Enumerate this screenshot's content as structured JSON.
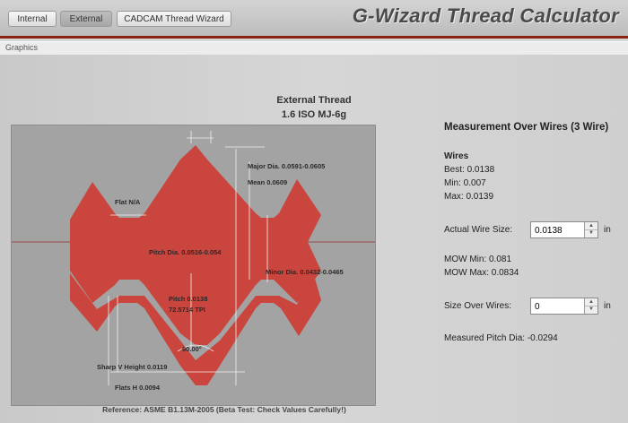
{
  "tabs": [
    {
      "label": "Internal",
      "active": false
    },
    {
      "label": "External",
      "active": true
    },
    {
      "label": "CADCAM Thread Wizard",
      "active": false
    }
  ],
  "app_title": "G-Wizard Thread Calculator",
  "section": {
    "label": "Graphics"
  },
  "thread": {
    "title_line1": "External Thread",
    "title_line2": "1.6 ISO MJ-6g"
  },
  "diagram": {
    "flat_label": "Flat N/A",
    "major_dia": "Major Dia. 0.0591-0.0605",
    "mean": "Mean 0.0609",
    "pitch_dia": "Pitch Dia. 0.0516-0.054",
    "minor_dia": "Minor Dia. 0.0432-0.0465",
    "pitch": "Pitch 0.0138",
    "tpi": "72.5714 TPI",
    "angle": "60.00°",
    "sharp_v": "Sharp V Height 0.0119",
    "flats": "Flats H 0.0094",
    "thread_color": "#c9453e",
    "bg_color": "#a3a3a3"
  },
  "reference": "Reference: ASME B1.13M-2005 (Beta Test: Check Values Carefully!)",
  "measurement": {
    "title": "Measurement Over Wires (3 Wire)",
    "wires_heading": "Wires",
    "best": "Best: 0.0138",
    "min": "Min: 0.007",
    "max": "Max: 0.0139",
    "actual_wire_label": "Actual Wire Size:",
    "actual_wire_value": "0.0138",
    "unit": "in",
    "mow_min": "MOW Min: 0.081",
    "mow_max": "MOW Max: 0.0834",
    "size_over_label": "Size Over Wires:",
    "size_over_value": "0",
    "measured_pitch": "Measured Pitch Dia: -0.0294"
  }
}
